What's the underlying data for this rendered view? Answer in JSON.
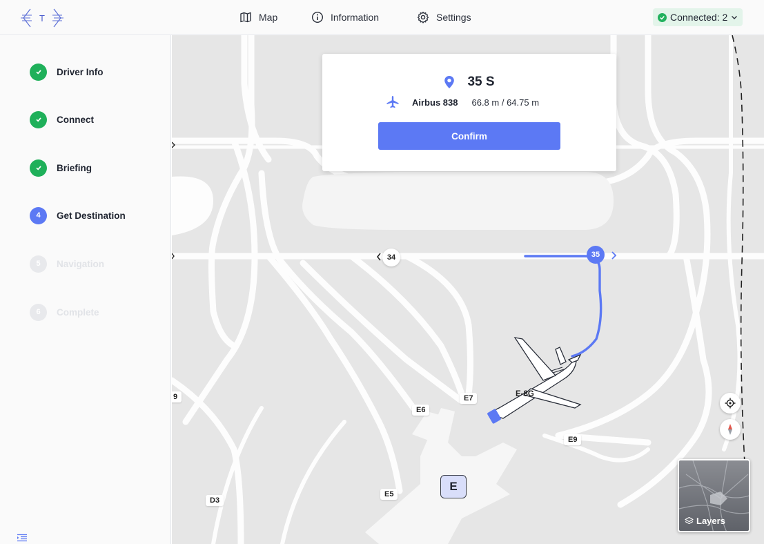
{
  "header": {
    "logo_letter": "T",
    "nav": [
      {
        "label": "Map",
        "icon": "map-icon"
      },
      {
        "label": "Information",
        "icon": "info-icon"
      },
      {
        "label": "Settings",
        "icon": "gear-icon"
      }
    ],
    "status": {
      "label": "Connected: 2",
      "color": "#22b15e"
    }
  },
  "sidebar": {
    "steps": [
      {
        "marker": "",
        "label": "Driver Info",
        "state": "done"
      },
      {
        "marker": "",
        "label": "Connect",
        "state": "done"
      },
      {
        "marker": "",
        "label": "Briefing",
        "state": "done"
      },
      {
        "marker": "4",
        "label": "Get Destination",
        "state": "active"
      },
      {
        "marker": "5",
        "label": "Navigation",
        "state": "pending"
      },
      {
        "marker": "6",
        "label": "Complete",
        "state": "pending"
      }
    ]
  },
  "card": {
    "destination": "35 S",
    "aircraft": "Airbus 838",
    "dimensions": "66.8 m / 64.75 m",
    "confirm_label": "Confirm"
  },
  "map": {
    "nodes": {
      "left": "34",
      "right": "35"
    },
    "labels": {
      "e9_left": "9",
      "e6": "E6",
      "e7": "E7",
      "e9": "E9",
      "e5": "E5",
      "d3": "D3",
      "aircraft": "E-8G"
    },
    "gate": "E",
    "layers_label": "Layers",
    "route_color": "#5c79f4"
  }
}
